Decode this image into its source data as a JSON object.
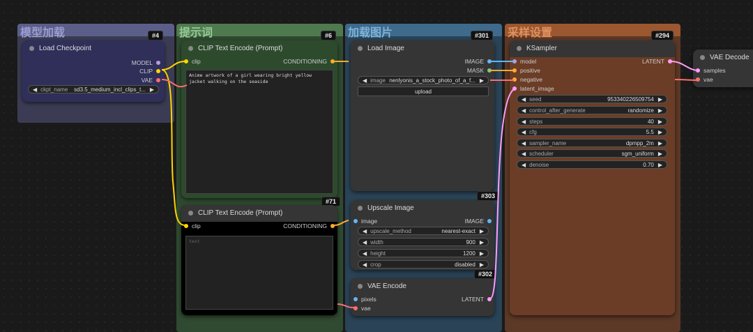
{
  "groups": {
    "model": {
      "title": "模型加载",
      "color": "#5c5e8a",
      "bg": "#3b3c54",
      "text": "#9b9cd0"
    },
    "prompt": {
      "title": "提示词",
      "color": "#4f7a4f",
      "bg": "#2f4a30",
      "text": "#96c996"
    },
    "image": {
      "title": "加载图片",
      "color": "#3e6a8c",
      "bg": "#2a4356",
      "text": "#7fb3d9"
    },
    "sampler": {
      "title": "采样设置",
      "color": "#9a5730",
      "bg": "#5c3826",
      "text": "#e0925f"
    }
  },
  "nodes": {
    "load_checkpoint": {
      "title": "Load Checkpoint",
      "badge": "#4",
      "outputs": [
        "MODEL",
        "CLIP",
        "VAE"
      ],
      "ckpt_label": "ckpt_name",
      "ckpt_value": "sd3.5_medium_incl_clips_t..."
    },
    "clip_pos": {
      "title": "CLIP Text Encode (Prompt)",
      "badge": "#6",
      "input": "clip",
      "output": "CONDITIONING",
      "text": "Anime artwork of a girl wearing bright yellow jacket walking on the seaside"
    },
    "clip_neg": {
      "title": "CLIP Text Encode (Prompt)",
      "badge": "#71",
      "input": "clip",
      "output": "CONDITIONING",
      "placeholder": "text"
    },
    "load_image": {
      "title": "Load Image",
      "badge": "#301",
      "outputs": [
        "IMAGE",
        "MASK"
      ],
      "image_label": "image",
      "image_value": "nenlyonis_a_stock_photo_of_a_f...",
      "upload_label": "upload"
    },
    "upscale": {
      "title": "Upscale Image",
      "badge": "#303",
      "badge_bottom": "#302",
      "input": "image",
      "output": "IMAGE",
      "widgets": [
        {
          "label": "upscale_method",
          "value": "nearest-exact"
        },
        {
          "label": "width",
          "value": "900"
        },
        {
          "label": "height",
          "value": "1200"
        },
        {
          "label": "crop",
          "value": "disabled"
        }
      ]
    },
    "vae_encode": {
      "title": "VAE Encode",
      "inputs": [
        "pixels",
        "vae"
      ],
      "output": "LATENT"
    },
    "ksampler": {
      "title": "KSampler",
      "badge": "#294",
      "inputs": [
        "model",
        "positive",
        "negative",
        "latent_image"
      ],
      "output": "LATENT",
      "widgets": [
        {
          "label": "seed",
          "value": "953340226509754"
        },
        {
          "label": "control_after_generate",
          "value": "randomize"
        },
        {
          "label": "steps",
          "value": "40"
        },
        {
          "label": "cfg",
          "value": "5.5"
        },
        {
          "label": "sampler_name",
          "value": "dpmpp_2m"
        },
        {
          "label": "scheduler",
          "value": "sgm_uniform"
        },
        {
          "label": "denoise",
          "value": "0.70"
        }
      ]
    },
    "vae_decode": {
      "title": "VAE Decode",
      "inputs": [
        "samples",
        "vae"
      ]
    }
  },
  "colors": {
    "model": "#b39ddb",
    "clip": "#ffd500",
    "vae": "#ff6e6e",
    "conditioning": "#ffa931",
    "image": "#64b5f6",
    "latent": "#ff9cf9",
    "mask": "#81c784"
  }
}
